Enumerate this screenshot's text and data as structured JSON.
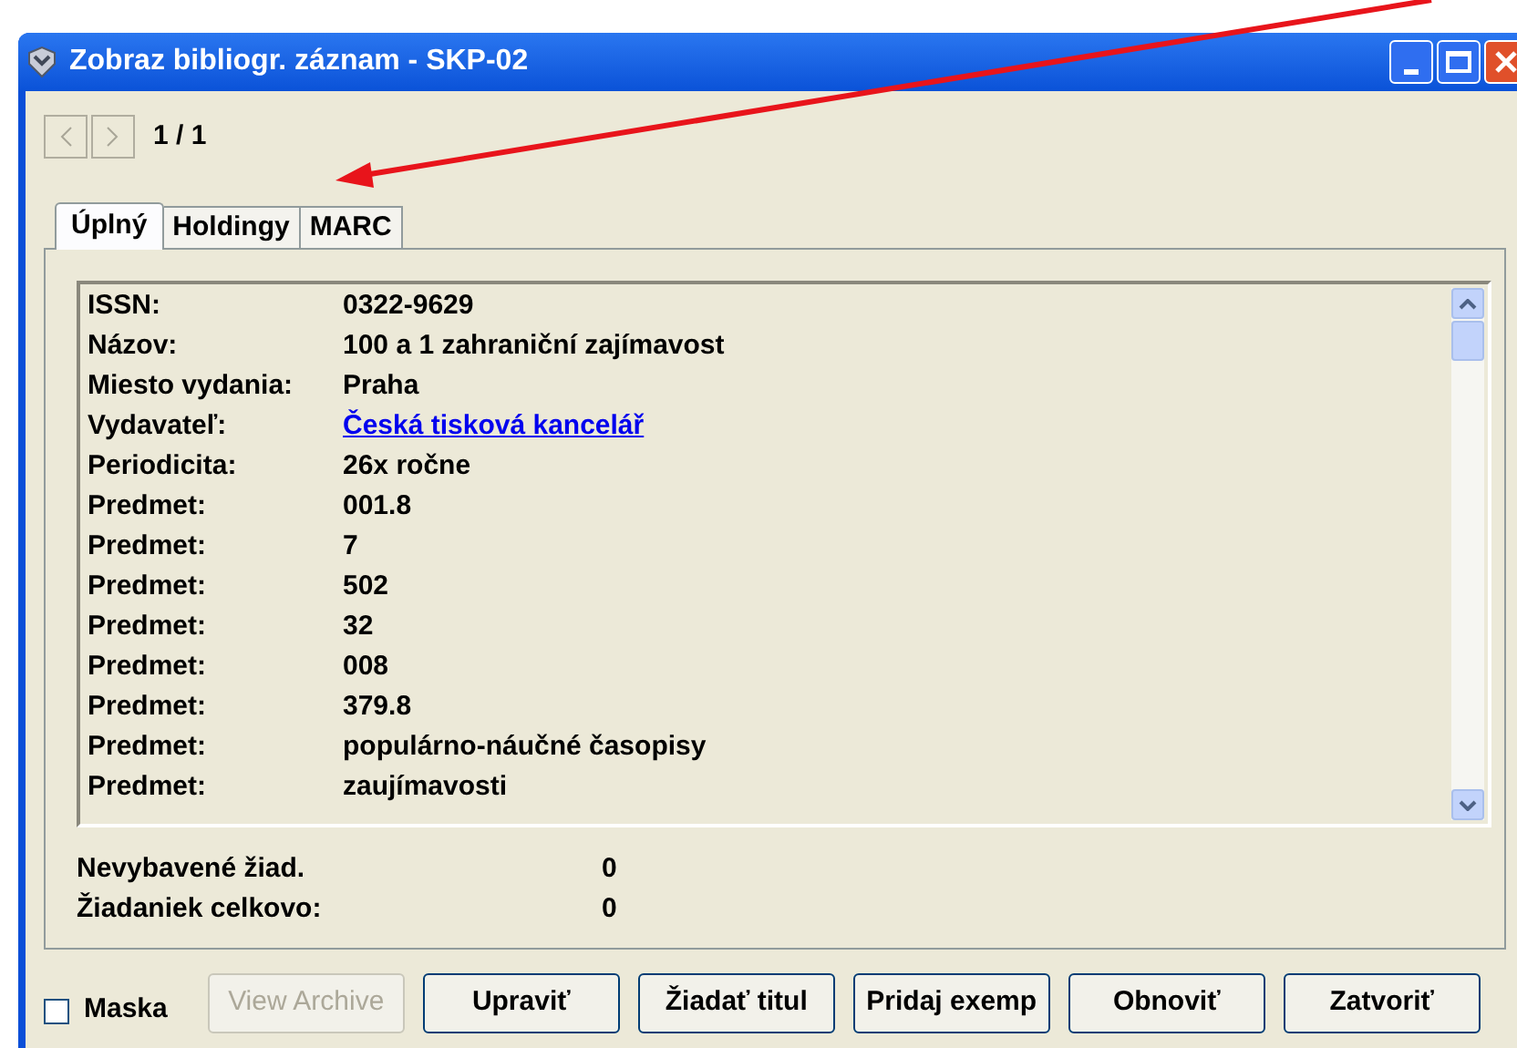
{
  "window": {
    "title": "Zobraz bibliogr. záznam - SKP-02"
  },
  "navigation": {
    "counter": "1 / 1"
  },
  "tabs": [
    {
      "label": "Úplný",
      "selected": true
    },
    {
      "label": "Holdingy",
      "selected": false
    },
    {
      "label": "MARC",
      "selected": false
    }
  ],
  "record": [
    {
      "label": "ISSN:",
      "value": "0322-9629",
      "kind": "text"
    },
    {
      "label": "Názov:",
      "value": "100 a 1 zahraniční zajímavost",
      "kind": "text"
    },
    {
      "label": "Miesto vydania:",
      "value": "Praha",
      "kind": "text"
    },
    {
      "label": "Vydavateľ:",
      "value": "Česká tisková kancelář",
      "kind": "link"
    },
    {
      "label": "Periodicita:",
      "value": "26x ročne",
      "kind": "text"
    },
    {
      "label": "Predmet:",
      "value": "001.8",
      "kind": "text"
    },
    {
      "label": "Predmet:",
      "value": "7",
      "kind": "text"
    },
    {
      "label": "Predmet:",
      "value": "502",
      "kind": "text"
    },
    {
      "label": "Predmet:",
      "value": "32",
      "kind": "text"
    },
    {
      "label": "Predmet:",
      "value": "008",
      "kind": "text"
    },
    {
      "label": "Predmet:",
      "value": "379.8",
      "kind": "text"
    },
    {
      "label": "Predmet:",
      "value": "populárno-náučné časopisy",
      "kind": "text"
    },
    {
      "label": "Predmet:",
      "value": "zaujímavosti",
      "kind": "text"
    }
  ],
  "summary": [
    {
      "label": "Nevybavené žiad.",
      "value": "0"
    },
    {
      "label": "Žiadaniek celkovo:",
      "value": "0"
    }
  ],
  "mask": {
    "label": "Maska",
    "checked": false
  },
  "buttons": [
    {
      "label": "View Archive",
      "disabled": true
    },
    {
      "label": "Upraviť",
      "disabled": false
    },
    {
      "label": "Žiadať titul",
      "disabled": false
    },
    {
      "label": "Pridaj exemp",
      "disabled": false
    },
    {
      "label": "Obnoviť",
      "disabled": false
    },
    {
      "label": "Zatvoriť",
      "disabled": false
    }
  ]
}
